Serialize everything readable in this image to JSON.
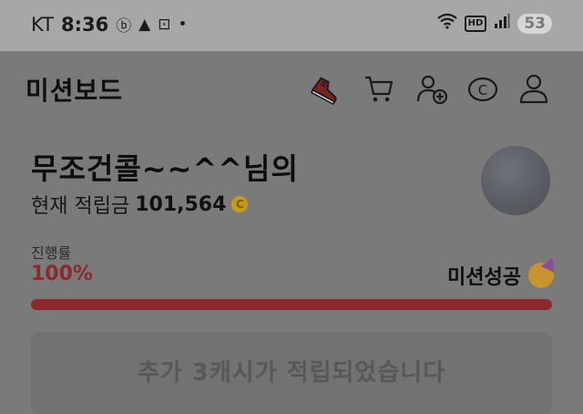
{
  "status_bar": {
    "carrier": "KT",
    "time": "8:36",
    "notification_icons": [
      "b-icon",
      "triangle-app-icon",
      "screenshot-icon",
      "dot-icon"
    ],
    "system_icons": [
      "wifi-icon",
      "hd-icon",
      "signal-icon"
    ],
    "hd_label": "HD",
    "battery": "53"
  },
  "header": {
    "title": "미션보드",
    "icons": [
      "sneaker-icon",
      "cart-icon",
      "add-user-icon",
      "coin-icon",
      "profile-icon"
    ]
  },
  "user": {
    "name": "무조건콜~~^^님의",
    "balance_label": "현재 적립금",
    "balance_value": "101,564",
    "currency_symbol": "C"
  },
  "progress": {
    "label": "진행률",
    "value_text": "100%",
    "fraction": 1.0,
    "status_text": "미션성공"
  },
  "notice": {
    "text": "추가 3캐시가 적립되었습니다"
  },
  "colors": {
    "accent": "#8a2a2f",
    "overlay": "#7a7a7a",
    "coin": "#c59a1c"
  }
}
